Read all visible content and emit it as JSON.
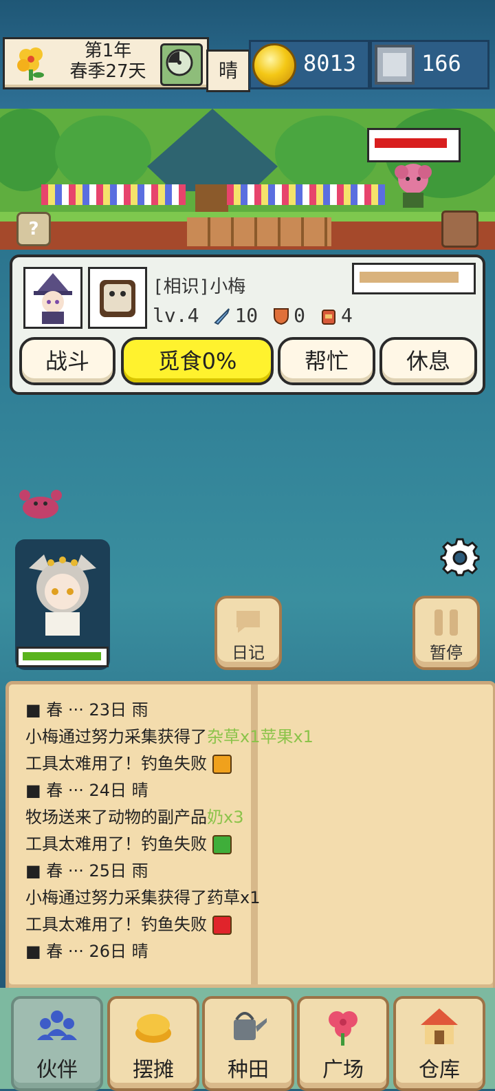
{
  "top_bar": {
    "date_line1": "第1年",
    "date_line2": "春季27天",
    "weather": "晴",
    "gold": "8013",
    "gems": "166",
    "icons": [
      "flower-icon",
      "clock-icon",
      "gold-coin-icon",
      "silver-gem-icon"
    ]
  },
  "scene": {
    "help_label": "?",
    "enemy_hp_fraction": 0.95
  },
  "companion": {
    "name": "[相识]小梅",
    "level": "lv.4",
    "attack": "10",
    "defense": "0",
    "bag": "4",
    "hunger_fraction": 0.95,
    "buttons": {
      "fight": "战斗",
      "forage": "觅食0%",
      "help": "帮忙",
      "rest": "休息"
    }
  },
  "middle": {
    "diary_label": "日记",
    "pause_label": "暂停",
    "char_hp_fraction": 1.0
  },
  "log": {
    "lines": [
      {
        "text": "■ 春 ··· 23日 雨",
        "extra": "",
        "face": ""
      },
      {
        "text": "小梅通过努力采集获得了",
        "extra": "杂草x1苹果x1",
        "face": ""
      },
      {
        "text": "工具太难用了！钓鱼失败",
        "extra": "",
        "face": "#f0a11c"
      },
      {
        "text": "■ 春 ··· 24日 晴",
        "extra": "",
        "face": ""
      },
      {
        "text": "牧场送来了动物的副产品",
        "extra": "奶x3",
        "face": ""
      },
      {
        "text": "工具太难用了！钓鱼失败",
        "extra": "",
        "face": "#3fae3a"
      },
      {
        "text": "■ 春 ··· 25日 雨",
        "extra": "",
        "face": ""
      },
      {
        "text": "小梅通过努力采集获得了药草x1",
        "extra": "",
        "face": ""
      },
      {
        "text": "工具太难用了！钓鱼失败",
        "extra": "",
        "face": "#e0242b"
      },
      {
        "text": "■ 春 ··· 26日 晴",
        "extra": "",
        "face": ""
      }
    ]
  },
  "nav": {
    "items": [
      {
        "label": "伙伴",
        "icon": "companions-icon"
      },
      {
        "label": "摆摊",
        "icon": "stall-icon"
      },
      {
        "label": "种田",
        "icon": "watering-can-icon"
      },
      {
        "label": "广场",
        "icon": "flower-square-icon"
      },
      {
        "label": "仓库",
        "icon": "warehouse-icon"
      }
    ]
  },
  "colors": {
    "accent_yellow": "#fff22e",
    "log_highlight": "#8bc34a",
    "hp_green": "#5ab31e",
    "enemy_hp_red": "#d81e1e"
  }
}
